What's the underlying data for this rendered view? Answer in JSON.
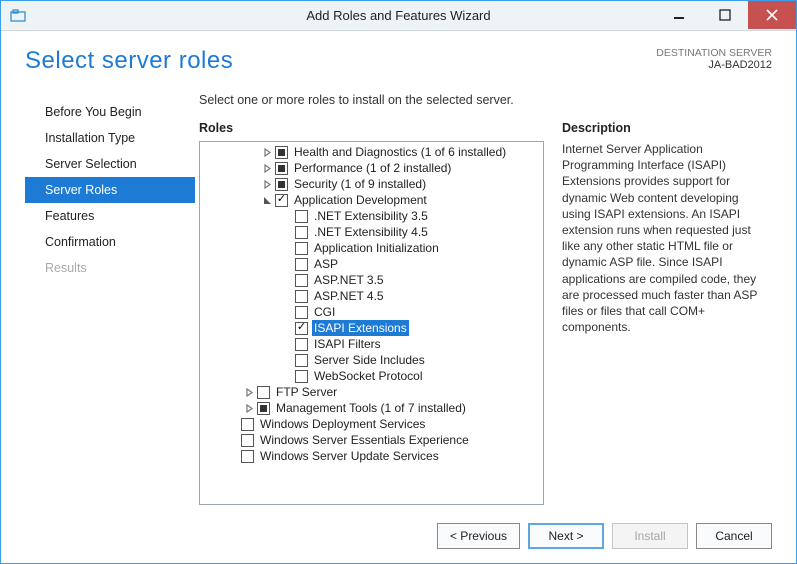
{
  "window": {
    "title": "Add Roles and Features Wizard"
  },
  "page": {
    "title": "Select server roles"
  },
  "destination": {
    "label": "DESTINATION SERVER",
    "server": "JA-BAD2012"
  },
  "prompt": "Select one or more roles to install on the selected server.",
  "headings": {
    "roles": "Roles",
    "description": "Description"
  },
  "nav": [
    {
      "id": "before",
      "label": "Before You Begin",
      "active": false,
      "disabled": false
    },
    {
      "id": "type",
      "label": "Installation Type",
      "active": false,
      "disabled": false
    },
    {
      "id": "sel",
      "label": "Server Selection",
      "active": false,
      "disabled": false
    },
    {
      "id": "roles",
      "label": "Server Roles",
      "active": true,
      "disabled": false
    },
    {
      "id": "feat",
      "label": "Features",
      "active": false,
      "disabled": false
    },
    {
      "id": "conf",
      "label": "Confirmation",
      "active": false,
      "disabled": false
    },
    {
      "id": "res",
      "label": "Results",
      "active": false,
      "disabled": true
    }
  ],
  "tree": [
    {
      "depth": 2,
      "expander": "closed",
      "check": "partial",
      "label": "Health and Diagnostics (1 of 6 installed)"
    },
    {
      "depth": 2,
      "expander": "closed",
      "check": "partial",
      "label": "Performance (1 of 2 installed)"
    },
    {
      "depth": 2,
      "expander": "closed",
      "check": "partial",
      "label": "Security (1 of 9 installed)"
    },
    {
      "depth": 2,
      "expander": "open",
      "check": "checked",
      "label": "Application Development"
    },
    {
      "depth": 3,
      "expander": "none",
      "check": "empty",
      "label": ".NET Extensibility 3.5"
    },
    {
      "depth": 3,
      "expander": "none",
      "check": "empty",
      "label": ".NET Extensibility 4.5"
    },
    {
      "depth": 3,
      "expander": "none",
      "check": "empty",
      "label": "Application Initialization"
    },
    {
      "depth": 3,
      "expander": "none",
      "check": "empty",
      "label": "ASP"
    },
    {
      "depth": 3,
      "expander": "none",
      "check": "empty",
      "label": "ASP.NET 3.5"
    },
    {
      "depth": 3,
      "expander": "none",
      "check": "empty",
      "label": "ASP.NET 4.5"
    },
    {
      "depth": 3,
      "expander": "none",
      "check": "empty",
      "label": "CGI"
    },
    {
      "depth": 3,
      "expander": "none",
      "check": "checked",
      "label": "ISAPI Extensions",
      "selected": true
    },
    {
      "depth": 3,
      "expander": "none",
      "check": "empty",
      "label": "ISAPI Filters"
    },
    {
      "depth": 3,
      "expander": "none",
      "check": "empty",
      "label": "Server Side Includes"
    },
    {
      "depth": 3,
      "expander": "none",
      "check": "empty",
      "label": "WebSocket Protocol"
    },
    {
      "depth": 1,
      "expander": "closed",
      "check": "empty",
      "label": "FTP Server"
    },
    {
      "depth": 1,
      "expander": "closed",
      "check": "partial",
      "label": "Management Tools (1 of 7 installed)"
    },
    {
      "depth": 0,
      "expander": "none",
      "check": "empty",
      "label": "Windows Deployment Services"
    },
    {
      "depth": 0,
      "expander": "none",
      "check": "empty",
      "label": "Windows Server Essentials Experience"
    },
    {
      "depth": 0,
      "expander": "none",
      "check": "empty",
      "label": "Windows Server Update Services"
    }
  ],
  "description": "Internet Server Application Programming Interface (ISAPI) Extensions provides support for dynamic Web content developing using ISAPI extensions. An ISAPI extension runs when requested just like any other static HTML file or dynamic ASP file. Since ISAPI applications are compiled code, they are processed much faster than ASP files or files that call COM+ components.",
  "buttons": {
    "previous": "< Previous",
    "next": "Next >",
    "install": "Install",
    "cancel": "Cancel"
  }
}
